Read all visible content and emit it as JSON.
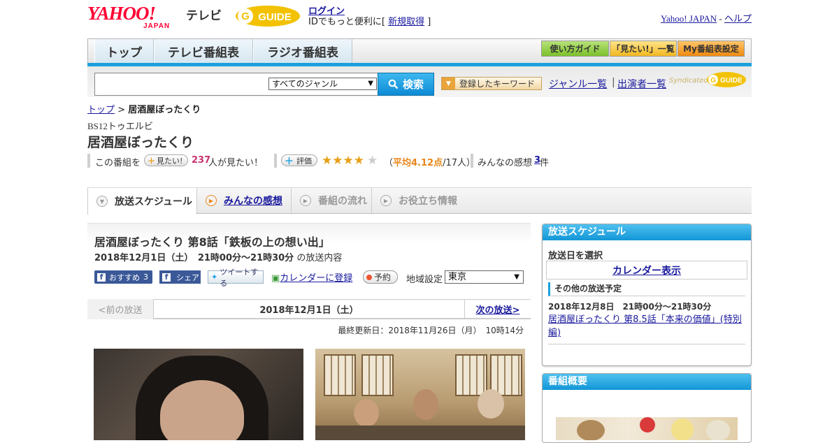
{
  "header": {
    "logo_yahoo": "YAHOO!",
    "logo_japan": "JAPAN",
    "logo_tv": "テレビ",
    "gguide": "GUIDE",
    "login": "ログイン",
    "login_note_prefix": "IDでもっと便利に[ ",
    "signup": "新規取得",
    "login_note_suffix": " ]",
    "yahoo_japan_link": "Yahoo! JAPAN",
    "dash": " - ",
    "help_link": "ヘルプ"
  },
  "nav": {
    "tabs": [
      "トップ",
      "テレビ番組表",
      "ラジオ番組表"
    ],
    "quick": [
      "使い方ガイド",
      "「見たい!」一覧",
      "My番組表設定"
    ]
  },
  "search": {
    "genre": "すべてのジャンル",
    "button": "検索",
    "keyword_button": "登録したキーワード",
    "genre_list": "ジャンル一覧",
    "sep": "|",
    "cast_list": "出演者一覧",
    "syndicated": "Syndicated"
  },
  "breadcrumb": {
    "top": "トップ",
    "sep": " > ",
    "current": "居酒屋ぼったくり"
  },
  "program": {
    "channel": "BS12トゥエルビ",
    "title": "居酒屋ぼったくり",
    "want_prefix": "この番組を",
    "want_button": "見たい!",
    "want_count": "237",
    "want_suffix": "人が見たい！",
    "rate_button": "評価",
    "stars": "★★★★",
    "star_empty": "★",
    "rating_open": "（",
    "rating_avg": "平均4.12点",
    "rating_count": "/17人）",
    "impressions_label": "みんなの感想",
    "impressions_count": "3",
    "impressions_unit": "件"
  },
  "program_tabs": [
    "放送スケジュール",
    "みんなの感想",
    "番組の流れ",
    "お役立ち情報"
  ],
  "episode": {
    "title": "居酒屋ぼったくり 第8話「鉄板の上の想い出」",
    "datetime": "2018年12月1日（土）　21時00分～21時30分",
    "datetime_suffix": " の放送内容",
    "fb_recommend": "おすすめ",
    "fb_count": "3",
    "fb_share": "シェア",
    "tweet": "ツイートする",
    "calendar_register": "カレンダーに登録",
    "reserve": "予約",
    "region_label": "地域設定",
    "region_value": "東京",
    "prev": "<前の放送",
    "current_date": "2018年12月1日（土）",
    "next": "次の放送>",
    "updated": "最終更新日：2018年11月26日（月）　10時14分"
  },
  "sidebar": {
    "schedule_title": "放送スケジュール",
    "pick_date": "放送日を選択",
    "calendar": "カレンダー表示",
    "other_title": "その他の放送予定",
    "other_time": "2018年12月8日　21時00分～21時30分",
    "other_link": "居酒屋ぼったくり 第8.5話「本来の価値」(特別編)",
    "overview_title": "番組概要"
  },
  "colors": {
    "accent_blue": "#1aa1dd",
    "link": "#1a1a9e",
    "yahoo_red": "#ff0033",
    "star": "#e8a016"
  }
}
